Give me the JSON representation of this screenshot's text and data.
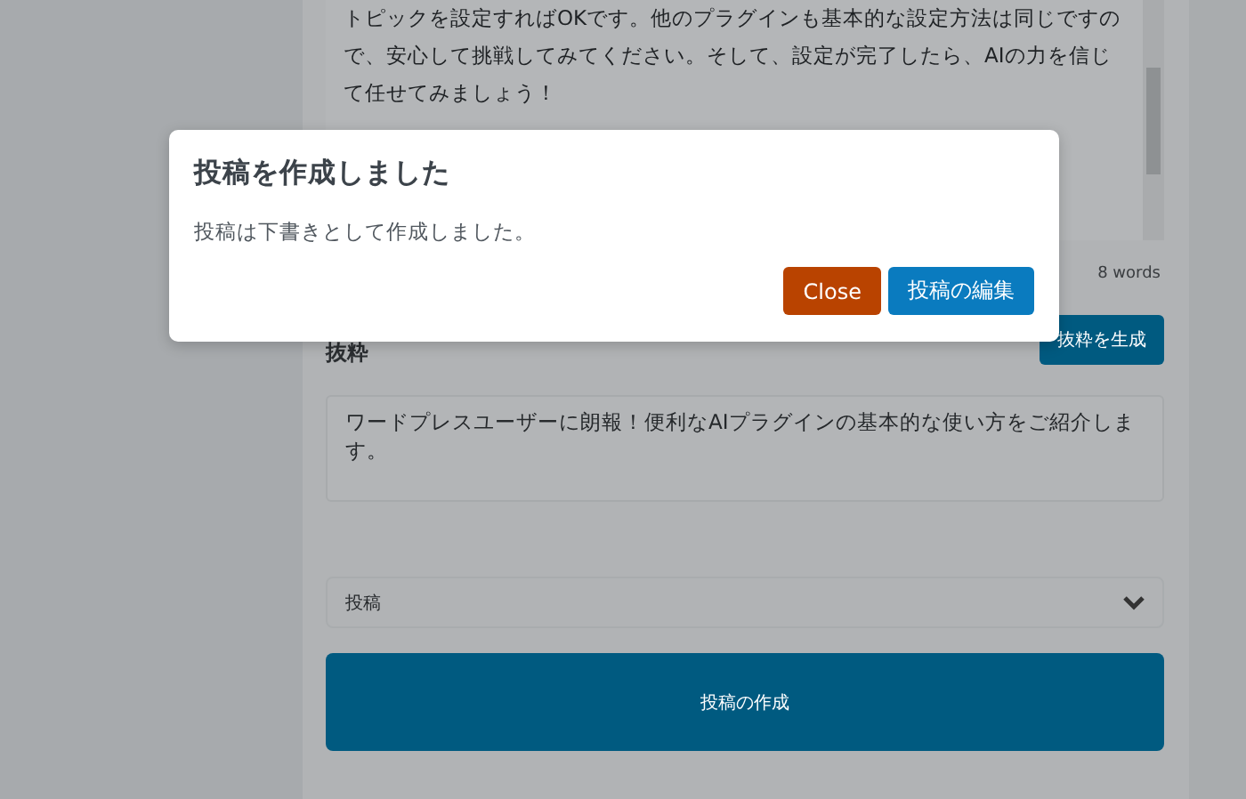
{
  "editor": {
    "body_text": "トピックを設定すればOKです。他のプラグインも基本的な設定方法は同じですので、安心して挑戦してみてください。そして、設定が完了したら、AIの力を信じて任せてみましょう！",
    "word_count": "8 words"
  },
  "excerpt": {
    "label": "抜粋",
    "generate_button": "抜粋を生成",
    "value": "ワードプレスユーザーに朗報！便利なAIプラグインの基本的な使い方をご紹介します。"
  },
  "post_type": {
    "value": "投稿"
  },
  "create_button": "投稿の作成",
  "dialog": {
    "title": "投稿を作成しました",
    "message": "投稿は下書きとして作成しました。",
    "buttons": [
      {
        "label": "Close",
        "kind": "secondary"
      },
      {
        "label": "投稿の編集",
        "kind": "primary"
      }
    ]
  }
}
